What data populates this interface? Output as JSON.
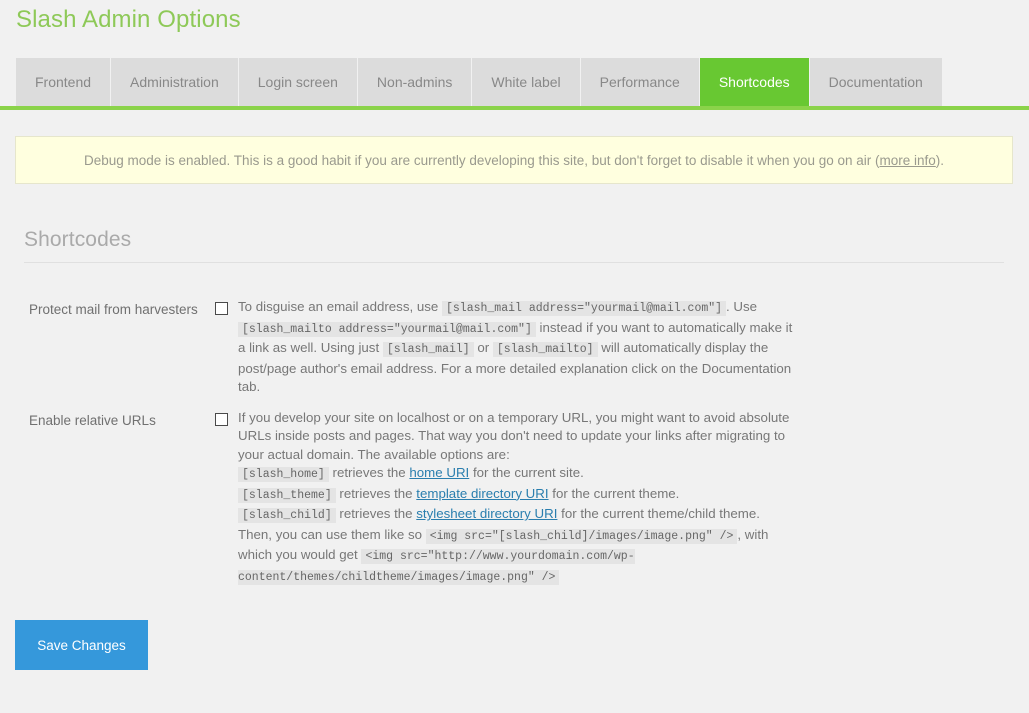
{
  "page": {
    "title": "Slash Admin Options"
  },
  "tabs": [
    {
      "label": "Frontend",
      "active": false
    },
    {
      "label": "Administration",
      "active": false
    },
    {
      "label": "Login screen",
      "active": false
    },
    {
      "label": "Non-admins",
      "active": false
    },
    {
      "label": "White label",
      "active": false
    },
    {
      "label": "Performance",
      "active": false
    },
    {
      "label": "Shortcodes",
      "active": true
    },
    {
      "label": "Documentation",
      "active": false
    }
  ],
  "notice": {
    "text_before": "Debug mode is enabled. This is a good habit if you are currently developing this site, but don't forget to disable it when you go on air (",
    "link_label": "more info",
    "text_after": ")."
  },
  "section": {
    "heading": "Shortcodes"
  },
  "settings": {
    "protect_mail": {
      "label": "Protect mail from harvesters",
      "checked": false,
      "desc": {
        "t1": "To disguise an email address, use ",
        "c1": "[slash_mail address=\"yourmail@mail.com\"]",
        "t2": ". Use ",
        "c2": "[slash_mailto address=\"yourmail@mail.com\"]",
        "t3": " instead if you want to automatically make it a link as well. Using just ",
        "c3": "[slash_mail]",
        "t4": " or ",
        "c4": "[slash_mailto]",
        "t5": " will automatically display the post/page author's email address. For a more detailed explanation click on the Documentation tab."
      }
    },
    "relative_urls": {
      "label": "Enable relative URLs",
      "checked": false,
      "desc": {
        "intro": "If you develop your site on localhost or on a temporary URL, you might want to avoid absolute URLs inside posts and pages. That way you don't need to update your links after migrating to your actual domain. The available options are:",
        "options": [
          {
            "code": "[slash_home]",
            "mid": " retrieves the ",
            "link": "home URI",
            "tail": " for the current site."
          },
          {
            "code": "[slash_theme]",
            "mid": " retrieves the ",
            "link": "template directory URI",
            "tail": " for the current theme."
          },
          {
            "code": "[slash_child]",
            "mid": " retrieves the ",
            "link": "stylesheet directory URI",
            "tail": " for the current theme/child theme."
          }
        ],
        "t1": "Then, you can use them like so ",
        "c1": "<img src=\"[slash_child]/images/image.png\" />",
        "t2": ", with which you would get ",
        "c2": "<img src=\"http://www.yourdomain.com/wp-content/themes/childtheme/images/image.png\" />"
      }
    }
  },
  "actions": {
    "save_label": "Save Changes"
  },
  "colors": {
    "accent_green": "#68c832",
    "title_green": "#8ec958",
    "tab_underline": "#8bd34a",
    "notice_bg": "#ffffdf",
    "save_blue": "#3598db",
    "link_blue": "#2a7eae"
  }
}
